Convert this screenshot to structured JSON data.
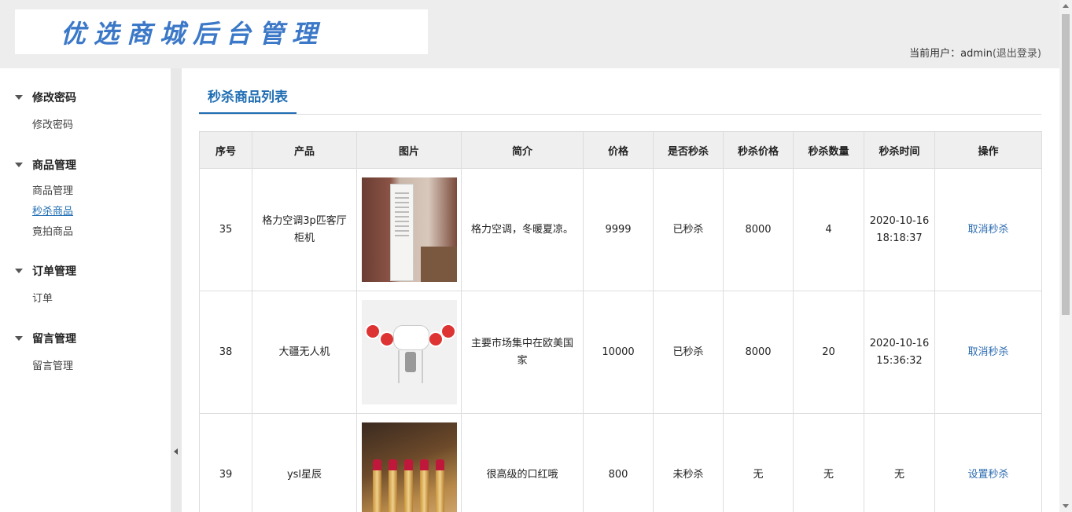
{
  "header": {
    "logo_text": "优选商城后台管理",
    "user_label": "当前用户：",
    "username": "admin",
    "logout_label": "(退出登录)"
  },
  "sidebar": {
    "groups": [
      {
        "title": "修改密码",
        "items": [
          {
            "label": "修改密码"
          }
        ]
      },
      {
        "title": "商品管理",
        "items": [
          {
            "label": "商品管理"
          },
          {
            "label": "秒杀商品"
          },
          {
            "label": "竟拍商品"
          }
        ]
      },
      {
        "title": "订单管理",
        "items": [
          {
            "label": "订单"
          }
        ]
      },
      {
        "title": "留言管理",
        "items": [
          {
            "label": "留言管理"
          }
        ]
      }
    ]
  },
  "main": {
    "page_title": "秒杀商品列表",
    "table": {
      "headers": [
        "序号",
        "产品",
        "图片",
        "简介",
        "价格",
        "是否秒杀",
        "秒杀价格",
        "秒杀数量",
        "秒杀时间",
        "操作"
      ],
      "rows": [
        {
          "id": "35",
          "product": "格力空调3p匹客厅柜机",
          "image": "air-conditioner-image",
          "desc": "格力空调，冬暖夏凉。",
          "price": "9999",
          "is_flash": "已秒杀",
          "flash_price": "8000",
          "flash_qty": "4",
          "flash_time": "2020-10-16 18:18:37",
          "action": "取消秒杀"
        },
        {
          "id": "38",
          "product": "大疆无人机",
          "image": "drone-image",
          "desc": "主要市场集中在欧美国家",
          "price": "10000",
          "is_flash": "已秒杀",
          "flash_price": "8000",
          "flash_qty": "20",
          "flash_time": "2020-10-16 15:36:32",
          "action": "取消秒杀"
        },
        {
          "id": "39",
          "product": "ysl星辰",
          "image": "lipstick-image",
          "desc": "很高级的口红哦",
          "price": "800",
          "is_flash": "未秒杀",
          "flash_price": "无",
          "flash_qty": "无",
          "flash_time": "无",
          "action": "设置秒杀"
        }
      ]
    }
  },
  "colors": {
    "accent": "#1f6db3",
    "link": "#2a6ab0",
    "logo": "#3b78c8"
  }
}
